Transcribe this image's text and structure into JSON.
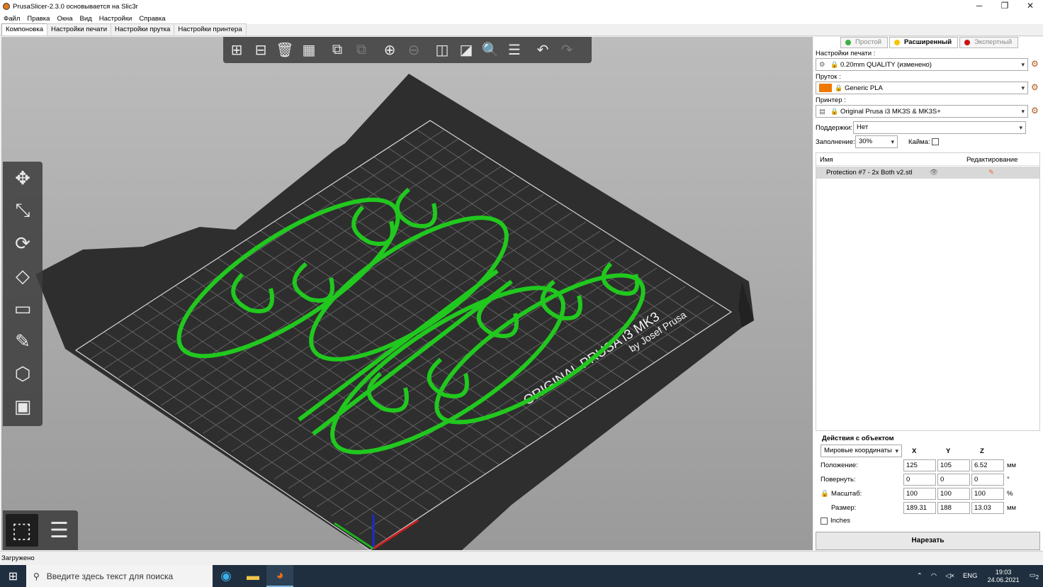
{
  "window": {
    "title": "PrusaSlicer-2.3.0 основывается на Slic3r",
    "controls": [
      "─",
      "❐",
      "✕"
    ]
  },
  "menu": [
    "Файл",
    "Правка",
    "Окна",
    "Вид",
    "Настройки",
    "Справка"
  ],
  "tabs": [
    {
      "label": "Компоновка",
      "active": true
    },
    {
      "label": "Настройки печати",
      "active": false
    },
    {
      "label": "Настройки прутка",
      "active": false
    },
    {
      "label": "Настройки принтера",
      "active": false
    }
  ],
  "toolbar_icons": [
    "add-icon",
    "delete-icon",
    "delete-all-icon",
    "arrange-icon",
    "copy-icon",
    "paste-icon",
    "add-instance-icon",
    "remove-instance-icon",
    "split-objects-icon",
    "split-parts-icon",
    "search-icon",
    "layers-editing-icon",
    "undo-icon",
    "redo-icon"
  ],
  "modes": [
    {
      "label": "Простой",
      "color": "#3cb043",
      "active": false
    },
    {
      "label": "Расширенный",
      "color": "#f5c400",
      "active": true
    },
    {
      "label": "Экспертный",
      "color": "#cc1111",
      "active": false
    }
  ],
  "print_settings": {
    "label": "Настройки печати :",
    "value": "0.20mm QUALITY (изменено)"
  },
  "filament": {
    "label": "Пруток :",
    "value": "Generic PLA",
    "color": "#f07800"
  },
  "printer": {
    "label": "Принтер :",
    "value": "Original Prusa i3 MK3S & MK3S+"
  },
  "supports": {
    "label": "Поддержки:",
    "value": "Нет"
  },
  "infill": {
    "label": "Заполнение:",
    "value": "30%"
  },
  "brim": {
    "label": "Кайма:",
    "checked": false
  },
  "object_list": {
    "col_name": "Имя",
    "col_edit": "Редактирование",
    "rows": [
      {
        "name": "Protection #7 - 2x Both v2.stl"
      }
    ]
  },
  "object_actions": {
    "title": "Действия с объектом",
    "coords": "Мировые координаты",
    "axes": [
      "X",
      "Y",
      "Z"
    ],
    "position": {
      "label": "Положение:",
      "values": [
        "125",
        "105",
        "6.52"
      ],
      "unit": "мм"
    },
    "rotate": {
      "label": "Повернуть:",
      "values": [
        "0",
        "0",
        "0"
      ],
      "unit": "°"
    },
    "scale": {
      "label": "Масштаб:",
      "values": [
        "100",
        "100",
        "100"
      ],
      "unit": "%"
    },
    "size": {
      "label": "Размер:",
      "values": [
        "189.31",
        "188",
        "13.03"
      ],
      "unit": "мм"
    },
    "inches": "Inches"
  },
  "slice_button": "Нарезать",
  "bed_text": {
    "line1": "ORIGINAL PRUSA i3 MK3",
    "line2": "by Josef Prusa"
  },
  "status": "Загружено",
  "taskbar": {
    "search_placeholder": "Введите здесь текст для поиска",
    "lang": "ENG",
    "time": "19:03",
    "date": "24.06.2021",
    "notifications": "2"
  },
  "colors": {
    "model": "#21c81e",
    "bed": "#2e2e2e",
    "background": "#a8a8a8"
  }
}
